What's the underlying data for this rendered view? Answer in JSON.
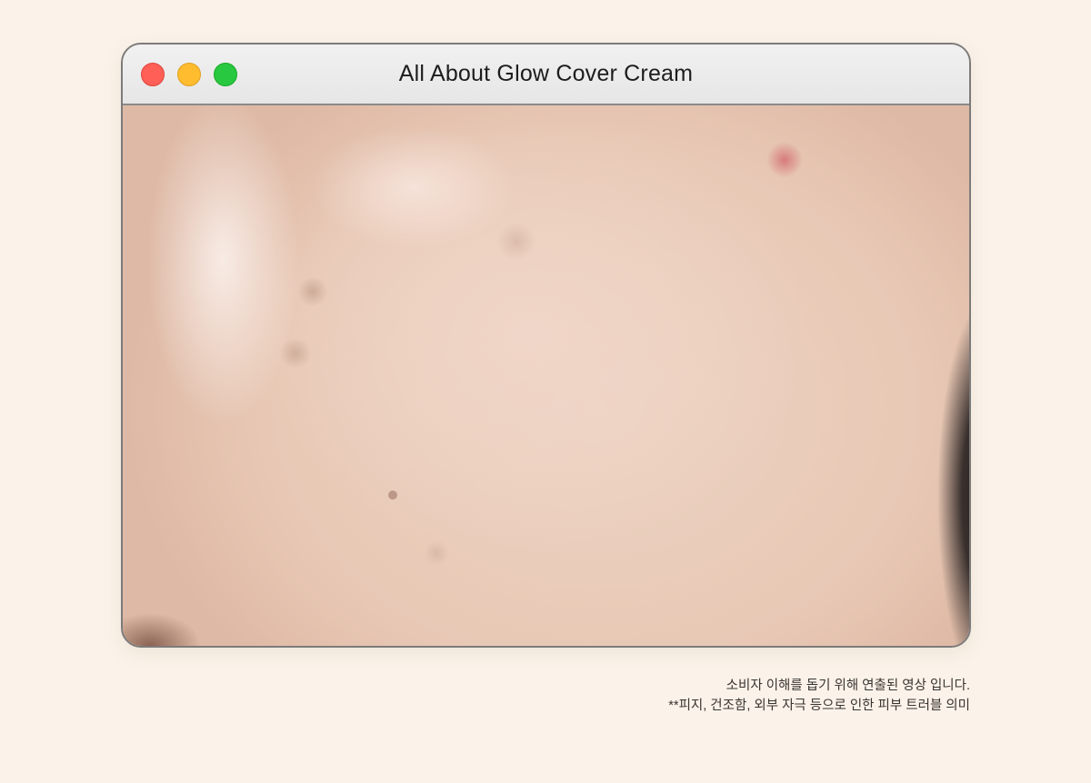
{
  "window": {
    "title": "All About Glow Cover Cream",
    "controls": {
      "close_color": "#ff5f57",
      "minimize_color": "#febc2e",
      "zoom_color": "#28c840"
    }
  },
  "media": {
    "kind": "video",
    "subject_icon": "skin-closeup-image"
  },
  "caption": {
    "line1": "소비자 이해를 돕기 위해 연출된 영상 입니다.",
    "line2": "**피지, 건조함, 외부 자극 등으로 인한 피부 트러블 의미"
  }
}
